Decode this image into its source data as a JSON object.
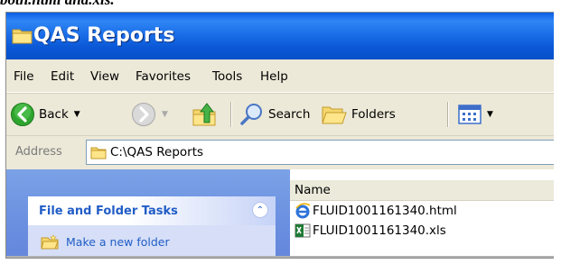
{
  "caption": "both.html and.xls.",
  "window": {
    "title": "QAS Reports"
  },
  "menu": {
    "items": [
      "File",
      "Edit",
      "View",
      "Favorites",
      "Tools",
      "Help"
    ]
  },
  "toolbar": {
    "back_label": "Back",
    "search_label": "Search",
    "folders_label": "Folders"
  },
  "address": {
    "label": "Address",
    "value": "C:\\QAS Reports"
  },
  "task_pane": {
    "title": "File and Folder Tasks",
    "links": [
      "Make a new folder"
    ]
  },
  "file_list": {
    "column_name": "Name",
    "files": [
      {
        "name": "FLUID1001161340.html",
        "icon": "ie-html-file-icon"
      },
      {
        "name": "FLUID1001161340.xls",
        "icon": "excel-file-icon"
      }
    ]
  },
  "colors": {
    "titlebar": "#0a57d6",
    "task_link": "#215dc6",
    "pane_bg": "#6a8fe0"
  }
}
